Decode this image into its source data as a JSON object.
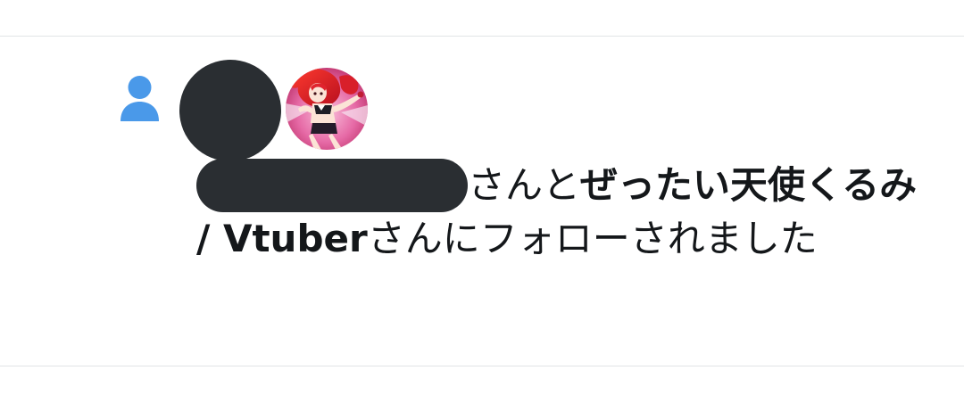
{
  "notification": {
    "type_icon": "person-icon",
    "accent_color": "#4a99e9",
    "avatars": [
      "redacted-avatar",
      "anime-avatar"
    ],
    "message": {
      "redacted_user": "",
      "connector": "さんと",
      "followed_by_name": "ぜったい天使くるみ / Vtuber",
      "suffix": "さんにフォローされました"
    }
  }
}
